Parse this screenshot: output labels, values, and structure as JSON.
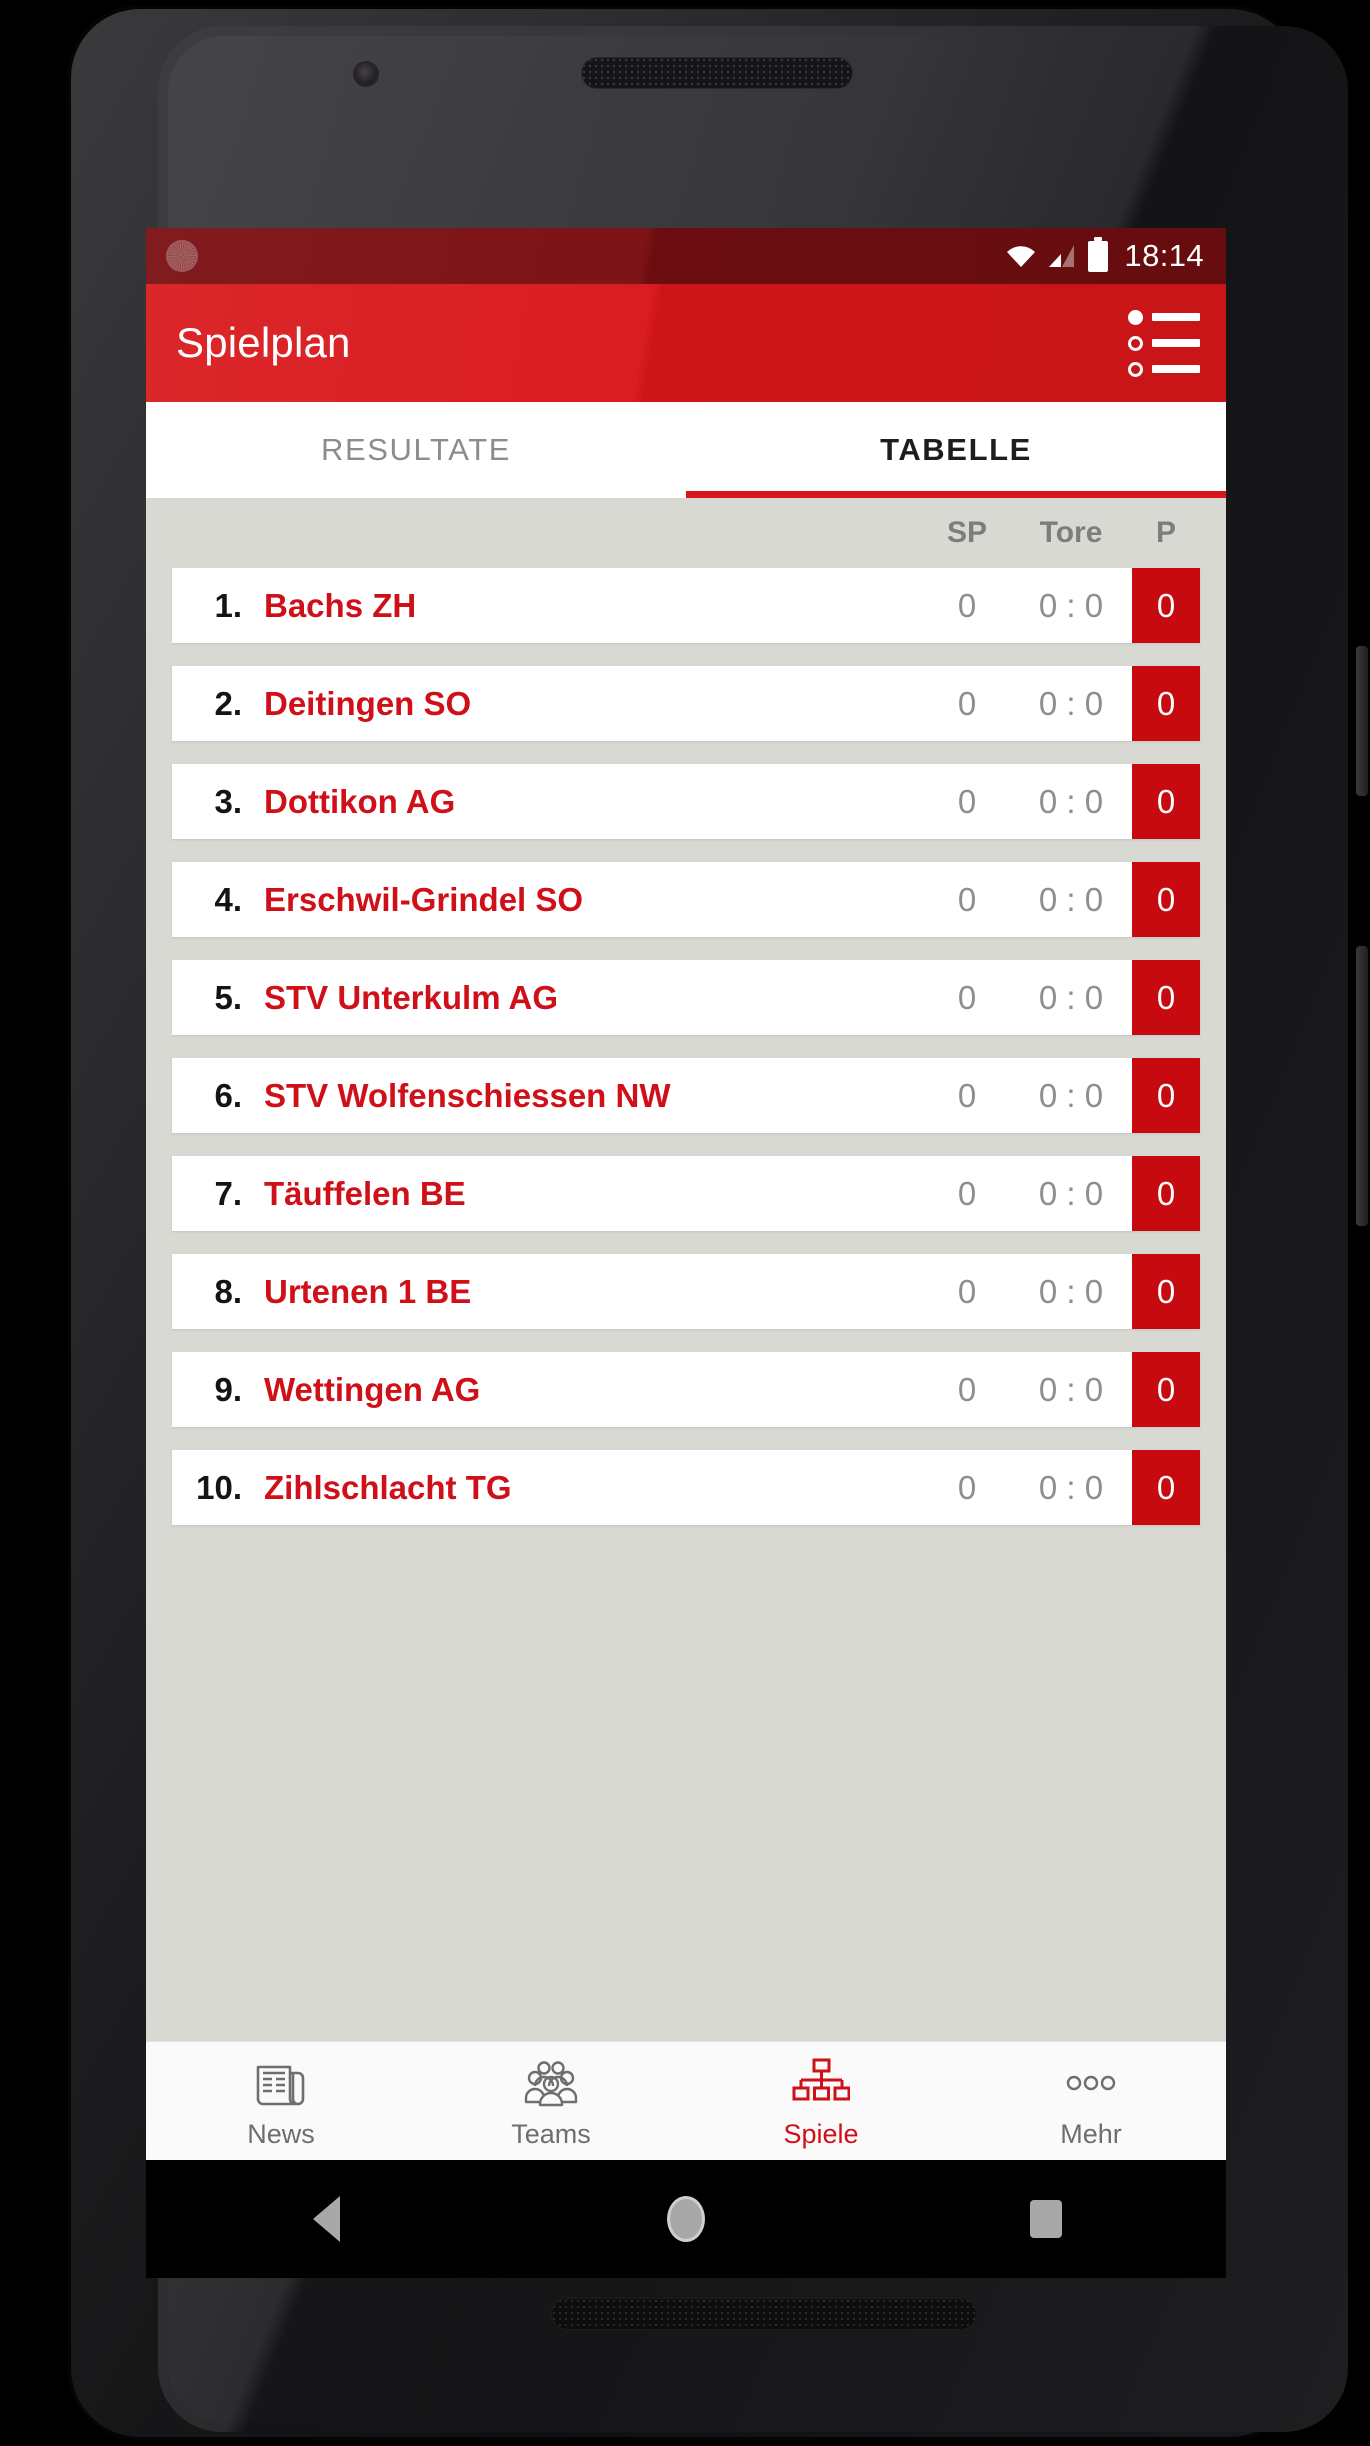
{
  "status_bar": {
    "time": "18:14",
    "icons": [
      "wifi-icon",
      "cellular-signal-icon",
      "battery-icon"
    ],
    "left_icon": "notification-dot-icon"
  },
  "app_bar": {
    "title": "Spielplan",
    "menu_icon": "list-menu-icon"
  },
  "tabs": [
    {
      "label": "RESULTATE",
      "active": false
    },
    {
      "label": "TABELLE",
      "active": true
    }
  ],
  "table": {
    "columns": [
      "",
      "",
      "SP",
      "Tore",
      "P"
    ],
    "headers": {
      "sp": "SP",
      "tore": "Tore",
      "p": "P"
    },
    "rows": [
      {
        "rank": "1.",
        "team": "Bachs ZH",
        "sp": "0",
        "tore": "0 : 0",
        "pts": "0"
      },
      {
        "rank": "2.",
        "team": "Deitingen SO",
        "sp": "0",
        "tore": "0 : 0",
        "pts": "0"
      },
      {
        "rank": "3.",
        "team": "Dottikon AG",
        "sp": "0",
        "tore": "0 : 0",
        "pts": "0"
      },
      {
        "rank": "4.",
        "team": "Erschwil-Grindel SO",
        "sp": "0",
        "tore": "0 : 0",
        "pts": "0"
      },
      {
        "rank": "5.",
        "team": "STV Unterkulm AG",
        "sp": "0",
        "tore": "0 : 0",
        "pts": "0"
      },
      {
        "rank": "6.",
        "team": "STV Wolfenschiessen NW",
        "sp": "0",
        "tore": "0 : 0",
        "pts": "0"
      },
      {
        "rank": "7.",
        "team": "Täuffelen BE",
        "sp": "0",
        "tore": "0 : 0",
        "pts": "0"
      },
      {
        "rank": "8.",
        "team": "Urtenen 1 BE",
        "sp": "0",
        "tore": "0 : 0",
        "pts": "0"
      },
      {
        "rank": "9.",
        "team": "Wettingen AG",
        "sp": "0",
        "tore": "0 : 0",
        "pts": "0"
      },
      {
        "rank": "10.",
        "team": "Zihlschlacht TG",
        "sp": "0",
        "tore": "0 : 0",
        "pts": "0"
      }
    ]
  },
  "bottom_nav": [
    {
      "label": "News",
      "icon": "newspaper-icon",
      "active": false
    },
    {
      "label": "Teams",
      "icon": "people-group-icon",
      "active": false
    },
    {
      "label": "Spiele",
      "icon": "org-chart-icon",
      "active": true
    },
    {
      "label": "Mehr",
      "icon": "more-dots-icon",
      "active": false
    }
  ],
  "android_nav": {
    "back": "back-triangle-icon",
    "home": "home-circle-icon",
    "recent": "recent-square-icon"
  },
  "colors": {
    "brand_red": "#d8161a",
    "dark_red": "#c70a10",
    "status_bar_red": "#7a0f12",
    "list_background": "#d9d9d4",
    "muted_text": "#8e8e8e"
  }
}
